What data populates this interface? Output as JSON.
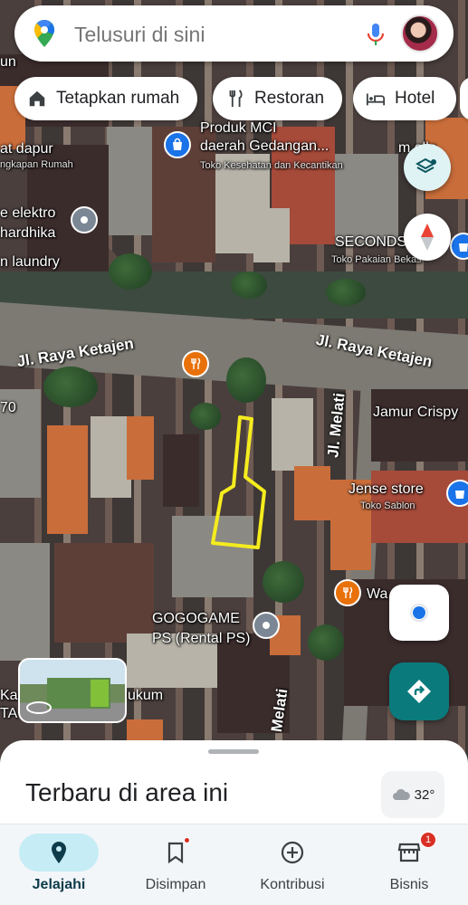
{
  "search": {
    "placeholder": "Telusuri di sini"
  },
  "chips": [
    {
      "label": "Tetapkan rumah",
      "icon": "home-icon"
    },
    {
      "label": "Restoran",
      "icon": "restaurant-icon"
    },
    {
      "label": "Hotel",
      "icon": "hotel-icon"
    }
  ],
  "map": {
    "streets": [
      "Jl. Raya Ketajen",
      "Jl. Raya Ketajen",
      "Jl. Melati",
      "Melati"
    ],
    "labels": {
      "produk_mci": "Produk MCI",
      "produk_mci_2": "daerah Gedangan...",
      "produk_mci_cat": "Toko Kesehatan dan Kecantikan",
      "dapur": "at dapur",
      "dapur_cat": "ngkapan Rumah",
      "elektro": "e elektro",
      "elektro_2": "hardhika",
      "laundry": "n laundry",
      "un": "un",
      "mollar": "m  olla",
      "second": "SECONDS",
      "second_cat": "Toko Pakaian Bekas",
      "seventy": "70",
      "jamur": "Jamur Crispy",
      "jense": "Jense store",
      "jense_cat": "Toko Sablon",
      "wa": "Wa         des",
      "gogogame": "GOGOGAME",
      "gogogame_2": "PS (Rental PS)",
      "kantor": "Ka",
      "kantor_2": "TA",
      "hukum": "ukum"
    }
  },
  "sheet": {
    "title": "Terbaru di area ini",
    "temperature": "32°"
  },
  "nav": [
    {
      "label": "Jelajahi",
      "active": true
    },
    {
      "label": "Disimpan",
      "active": false
    },
    {
      "label": "Kontribusi",
      "active": false
    },
    {
      "label": "Bisnis",
      "active": false,
      "badge": "1"
    }
  ],
  "colors": {
    "accent": "#0b7a7c",
    "nav_active_bg": "#c6ecf5",
    "highlight_outline": "#f5ec1e"
  }
}
